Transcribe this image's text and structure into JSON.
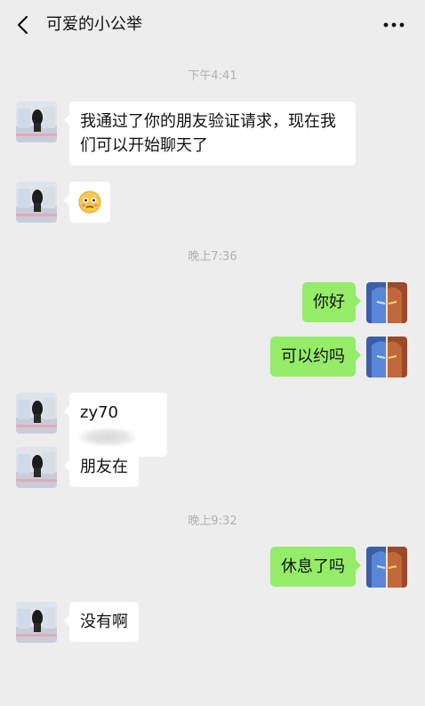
{
  "header": {
    "title": "可爱的小公举",
    "back_icon": "chevron-left-icon",
    "more_icon": "more-dots-icon"
  },
  "timestamps": [
    "下午4:41",
    "晚上7:36",
    "晚上9:32"
  ],
  "messages": [
    {
      "side": "them",
      "text": "我通过了你的朋友验证请求，现在我们可以开始聊天了"
    },
    {
      "side": "them",
      "text": "",
      "emoji": "flushed-smiley-emoji"
    },
    {
      "side": "me",
      "text": "你好"
    },
    {
      "side": "me",
      "text": "可以约吗"
    },
    {
      "side": "them",
      "text": "zy70"
    },
    {
      "side": "them",
      "text": "朋友在"
    },
    {
      "side": "me",
      "text": "休息了吗"
    },
    {
      "side": "them",
      "text": "没有啊"
    }
  ],
  "colors": {
    "background": "#ededed",
    "my_bubble": "#95ec69",
    "their_bubble": "#ffffff",
    "timestamp": "#b0b0b0"
  }
}
